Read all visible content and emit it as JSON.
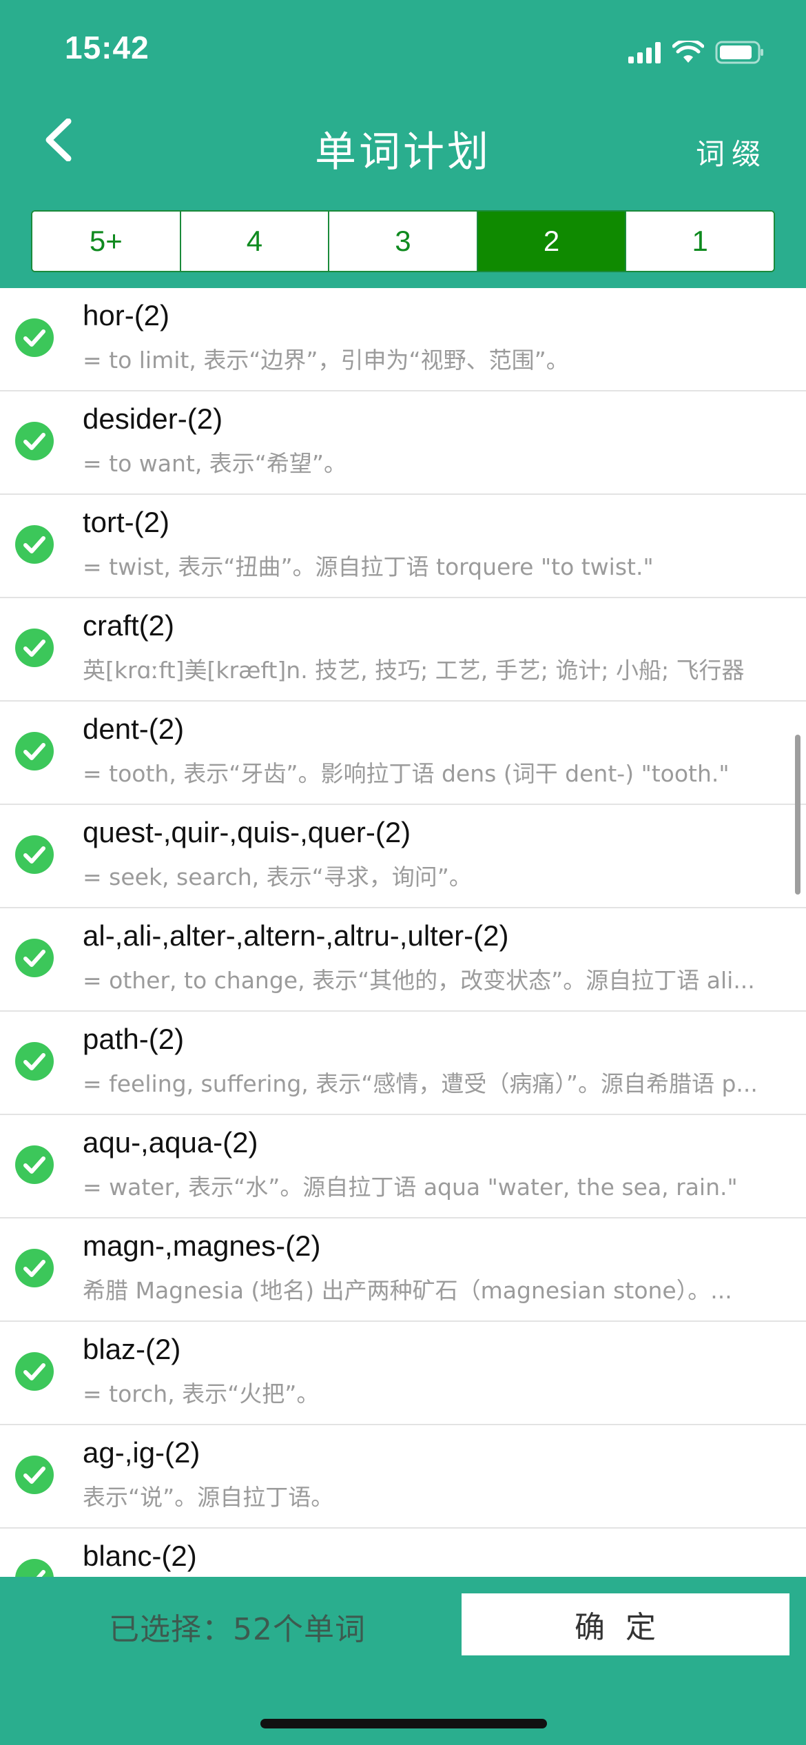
{
  "colors": {
    "accent": "#2aae8e",
    "segment_active": "#0f8a00",
    "check": "#3cc75a"
  },
  "status_bar": {
    "time": "15:42",
    "icons": [
      "signal-icon",
      "wifi-icon",
      "battery-icon"
    ]
  },
  "nav": {
    "title": "单词计划",
    "right_label": "词缀",
    "back_icon": "chevron-left-icon"
  },
  "segments": [
    {
      "label": "5+",
      "active": false
    },
    {
      "label": "4",
      "active": false
    },
    {
      "label": "3",
      "active": false
    },
    {
      "label": "2",
      "active": true
    },
    {
      "label": "1",
      "active": false
    }
  ],
  "items": [
    {
      "title": "hor-(2)",
      "subtitle": "= to limit, 表示“边界”，引申为“视野、范围”。"
    },
    {
      "title": "desider-(2)",
      "subtitle": "= to want, 表示“希望”。"
    },
    {
      "title": "tort-(2)",
      "subtitle": "= twist, 表示“扭曲”。源自拉丁语 torquere \"to twist.\""
    },
    {
      "title": "craft(2)",
      "subtitle": "英[krɑːft]美[kræft]n. 技艺, 技巧; 工艺, 手艺; 诡计; 小船; 飞行器"
    },
    {
      "title": "dent-(2)",
      "subtitle": "= tooth, 表示“牙齿”。影响拉丁语 dens (词干 dent-) \"tooth.\""
    },
    {
      "title": "quest-,quir-,quis-,quer-(2)",
      "subtitle": "= seek, search, 表示“寻求，询问”。"
    },
    {
      "title": "al-,ali-,alter-,altern-,altru-,ulter-(2)",
      "subtitle": "= other, to change, 表示“其他的，改变状态”。源自拉丁语 ali..."
    },
    {
      "title": "path-(2)",
      "subtitle": "= feeling, suffering, 表示“感情，遭受（病痛）”。源自希腊语 p..."
    },
    {
      "title": "aqu-,aqua-(2)",
      "subtitle": "= water, 表示“水”。源自拉丁语 aqua \"water, the sea, rain.\""
    },
    {
      "title": "magn-,magnes-(2)",
      "subtitle": "希腊 Magnesia (地名) 出产两种矿石（magnesian stone）。..."
    },
    {
      "title": "blaz-(2)",
      "subtitle": "= torch, 表示“火把”。"
    },
    {
      "title": "ag-,ig-(2)",
      "subtitle": "表示“说”。源自拉丁语。"
    },
    {
      "title": "blanc-(2)",
      "subtitle": ""
    }
  ],
  "footer": {
    "selected_text": "已选择：52个单词",
    "confirm_label": "确定"
  }
}
